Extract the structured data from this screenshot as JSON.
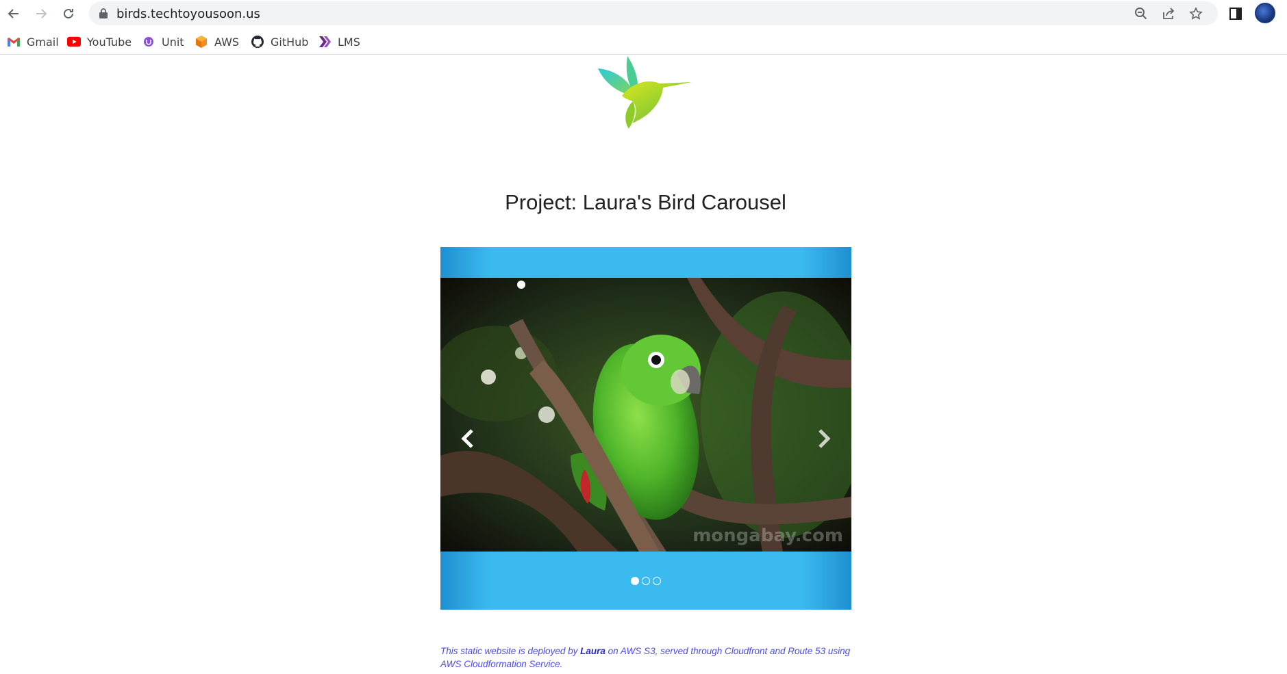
{
  "browser": {
    "url": "birds.techtoyousoon.us",
    "bookmarks": [
      {
        "label": "Gmail",
        "icon": "gmail-icon"
      },
      {
        "label": "YouTube",
        "icon": "youtube-icon"
      },
      {
        "label": "Unit",
        "icon": "unit-icon"
      },
      {
        "label": "AWS",
        "icon": "aws-icon"
      },
      {
        "label": "GitHub",
        "icon": "github-icon"
      },
      {
        "label": "LMS",
        "icon": "lms-icon"
      }
    ]
  },
  "page": {
    "title": "Project: Laura's Bird Carousel",
    "carousel": {
      "watermark": "mongabay.com",
      "slide_count": 3,
      "active_slide": 1,
      "accent_color": "#3bbaef"
    },
    "footer": {
      "text_before": "This static website is deployed by ",
      "author": "Laura",
      "text_after": " on AWS S3, served through Cloudfront and Route 53 using AWS Cloudformation Service."
    }
  }
}
